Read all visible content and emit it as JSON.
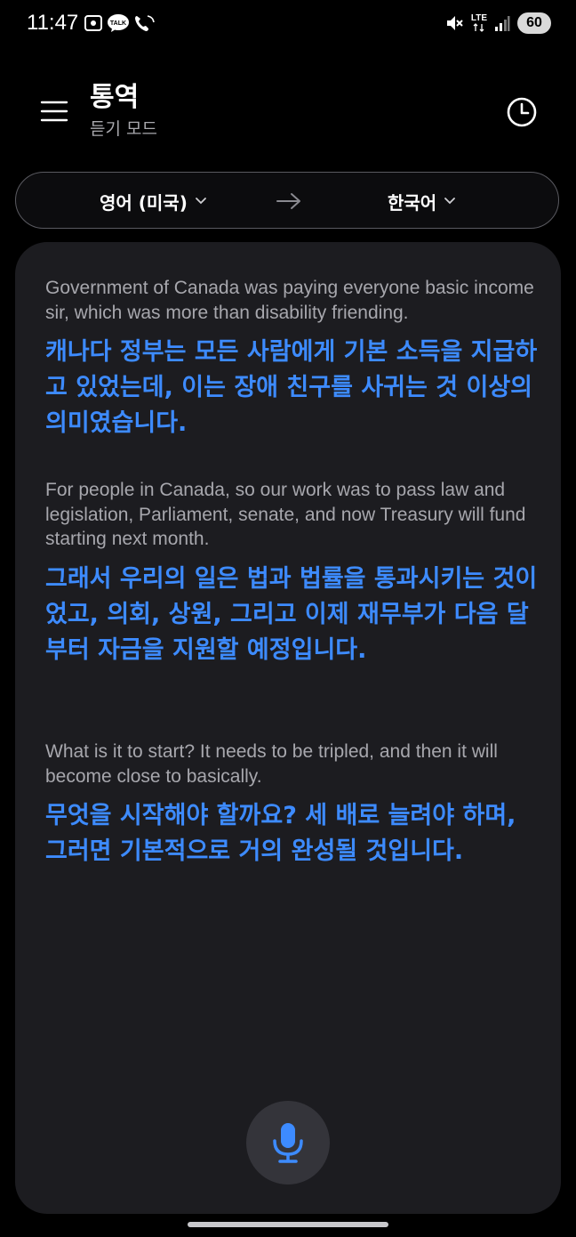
{
  "status_bar": {
    "time": "11:47",
    "network": "LTE",
    "battery": "60"
  },
  "header": {
    "title": "통역",
    "subtitle": "듣기 모드"
  },
  "languages": {
    "source": "영어 (미국)",
    "target": "한국어"
  },
  "transcript": [
    {
      "source": "Government of Canada was paying everyone basic income sir, which was more than disability friending.",
      "translation": "캐나다 정부는 모든 사람에게 기본 소득을 지급하고 있었는데, 이는 장애 친구를 사귀는 것 이상의 의미였습니다."
    },
    {
      "source": "For people in Canada, so our work was to pass law and legislation, Parliament, senate, and now Treasury will fund starting next month.",
      "translation": "그래서 우리의 일은 법과 법률을 통과시키는 것이었고, 의회, 상원, 그리고 이제 재무부가 다음 달부터 자금을 지원할 예정입니다."
    },
    {
      "source": "What is it to start? It needs to be tripled, and then it will become close to basically.",
      "translation": "무엇을 시작해야 할까요? 세 배로 늘려야 하며, 그러면 기본적으로 거의 완성될 것입니다."
    }
  ],
  "colors": {
    "accent": "#3d8bff",
    "card_background": "#1c1c20",
    "source_text": "#a7a7ad"
  },
  "icons": {
    "menu": "hamburger-icon",
    "history": "clock-icon",
    "swap": "arrow-right-icon",
    "mic": "microphone-icon"
  }
}
